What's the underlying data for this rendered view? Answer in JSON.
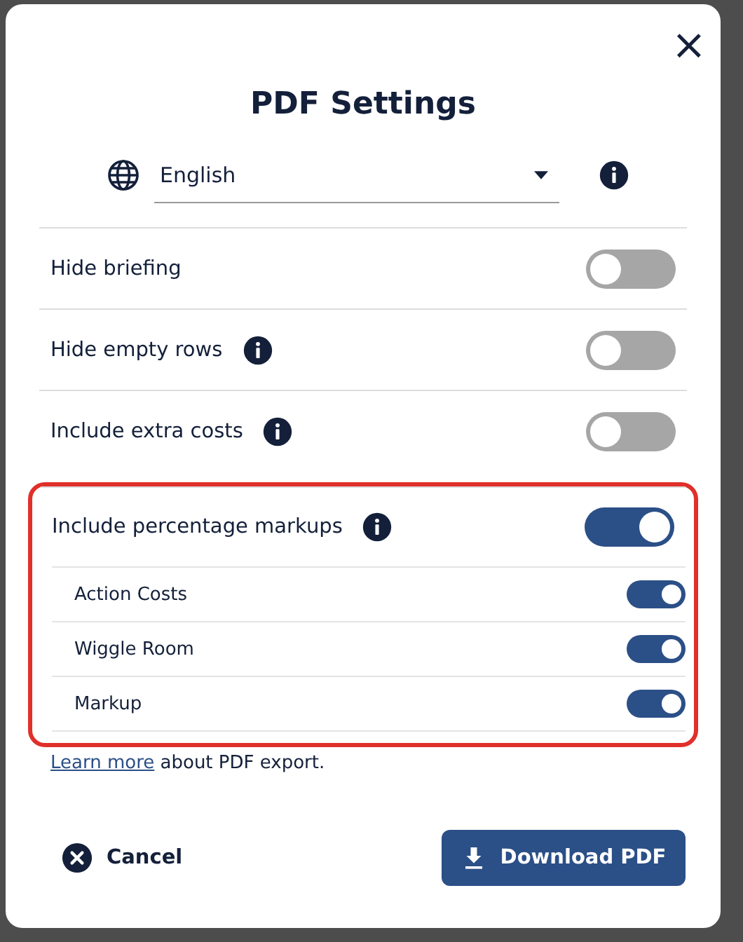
{
  "dialog": {
    "title": "PDF Settings",
    "close": "×"
  },
  "language": {
    "value": "English",
    "info": true
  },
  "settings": [
    {
      "label": "Hide briefing",
      "info": false,
      "on": false,
      "highlighted": false
    },
    {
      "label": "Hide empty rows",
      "info": true,
      "on": false,
      "highlighted": false
    },
    {
      "label": "Include extra costs",
      "info": true,
      "on": false,
      "highlighted": false
    },
    {
      "label": "Include percentage markups",
      "info": true,
      "on": true,
      "highlighted": true,
      "children": [
        {
          "label": "Action Costs",
          "on": true
        },
        {
          "label": "Wiggle Room",
          "on": true
        },
        {
          "label": "Markup",
          "on": true
        }
      ]
    }
  ],
  "footnote": {
    "link": "Learn more",
    "text": " about PDF export."
  },
  "buttons": [
    {
      "kind": "cancel",
      "label": "Cancel"
    },
    {
      "kind": "download",
      "label": "Download PDF"
    }
  ]
}
